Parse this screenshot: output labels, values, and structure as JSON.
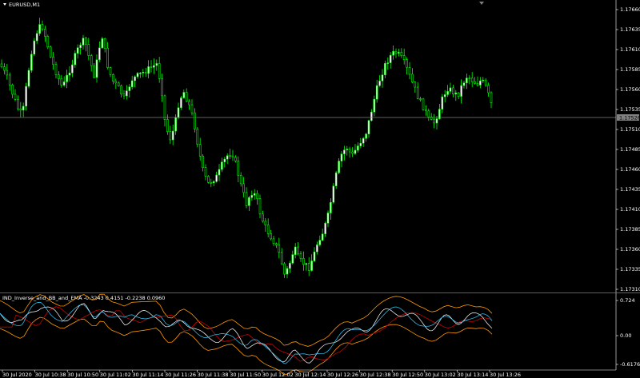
{
  "window": {
    "symbol_title": "EURUSD,M1",
    "collapse_icon": "triangle-down-icon",
    "shift_marker_icon": "triangle-down-icon"
  },
  "price_axis": {
    "labels": [
      "1.17660",
      "1.17635",
      "1.17610",
      "1.17585",
      "1.17560",
      "1.17535",
      "1.17510",
      "1.17485",
      "1.17460",
      "1.17435",
      "1.17410",
      "1.17385",
      "1.17360",
      "1.17335",
      "1.17310"
    ],
    "current_price": "1.17526"
  },
  "indicator": {
    "title": "IND_Inverse_and_BB_and_EMA -0.3243 0.4151 -0.2238 0.0960",
    "scale_labels": [
      "0.724",
      "0.00",
      "-0.6176"
    ]
  },
  "time_axis": {
    "labels": [
      "30 Jul 2020",
      "30 Jul 10:38",
      "30 Jul 10:50",
      "30 Jul 11:02",
      "30 Jul 11:14",
      "30 Jul 11:26",
      "30 Jul 11:38",
      "30 Jul 11:50",
      "30 Jul 12:02",
      "30 Jul 12:14",
      "30 Jul 12:26",
      "30 Jul 12:38",
      "30 Jul 12:50",
      "30 Jul 13:02",
      "30 Jul 13:14",
      "30 Jul 13:26"
    ]
  },
  "colors": {
    "background": "#000000",
    "candle": "#00ff00",
    "candle_bull_body": "#ffffff",
    "axis_text": "#ffffff",
    "grid_line": "#808080",
    "price_line": "#808080",
    "bb_band": "#ff9900",
    "ema_line": "#cc0000",
    "inverse_line": "#ffffff",
    "signal_line": "#33ccff"
  }
}
